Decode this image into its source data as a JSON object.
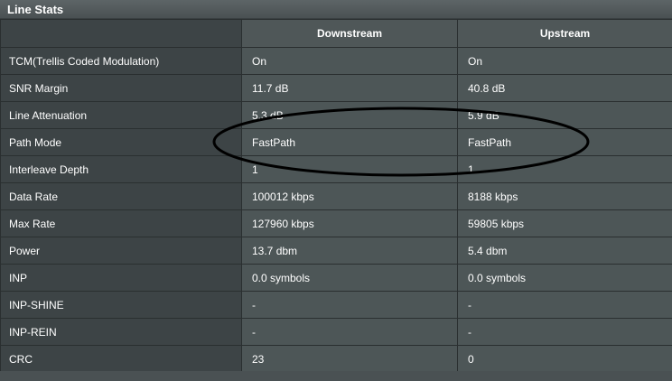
{
  "panel": {
    "title": "Line Stats"
  },
  "table": {
    "headers": [
      "",
      "Downstream",
      "Upstream"
    ],
    "rows": [
      {
        "label": "TCM(Trellis Coded Modulation)",
        "downstream": "On",
        "upstream": "On"
      },
      {
        "label": "SNR Margin",
        "downstream": "11.7 dB",
        "upstream": "40.8 dB"
      },
      {
        "label": "Line Attenuation",
        "downstream": "5.3 dB",
        "upstream": "5.9 dB"
      },
      {
        "label": "Path Mode",
        "downstream": "FastPath",
        "upstream": "FastPath"
      },
      {
        "label": "Interleave Depth",
        "downstream": "1",
        "upstream": "1"
      },
      {
        "label": "Data Rate",
        "downstream": "100012 kbps",
        "upstream": "8188 kbps"
      },
      {
        "label": "Max Rate",
        "downstream": "127960 kbps",
        "upstream": "59805 kbps"
      },
      {
        "label": "Power",
        "downstream": "13.7 dbm",
        "upstream": "5.4 dbm"
      },
      {
        "label": "INP",
        "downstream": "0.0 symbols",
        "upstream": "0.0 symbols"
      },
      {
        "label": "INP-SHINE",
        "downstream": "-",
        "upstream": "-"
      },
      {
        "label": "INP-REIN",
        "downstream": "-",
        "upstream": "-"
      },
      {
        "label": "CRC",
        "downstream": "23",
        "upstream": "0"
      }
    ]
  },
  "colors": {
    "annotation_stroke": "#000000"
  }
}
